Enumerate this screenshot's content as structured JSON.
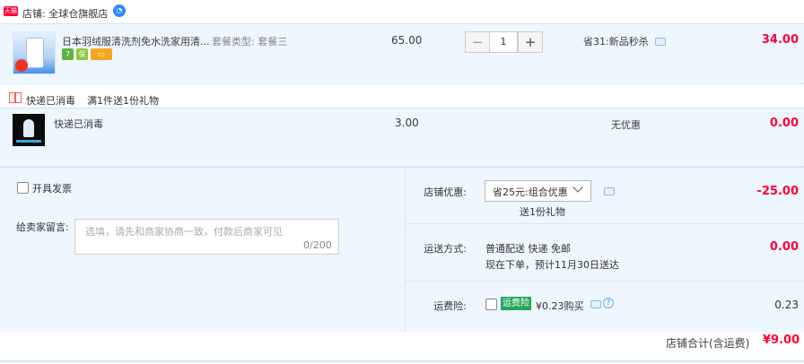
{
  "store": {
    "badge": "天猫",
    "name": "店铺: 全球仓旗舰店",
    "chat_icon": "wangwang-icon"
  },
  "items": [
    {
      "title": "日本羽绒服清洗剂免水洗家用清...",
      "sku": "套餐类型: 套餐三",
      "price": "65.00",
      "quantity": "1",
      "minus": "−",
      "plus": "+",
      "promo": "省31:新品秒杀",
      "subtotal": "34.00",
      "service_tags": [
        {
          "text": "7",
          "color": "#5ab33f"
        },
        {
          "text": "保",
          "color": "#8fc63d"
        },
        {
          "text": "▭",
          "color": "#f5a623"
        }
      ]
    },
    {
      "title": "快递已消毒",
      "price": "3.00",
      "promo": "无优惠",
      "subtotal": "0.00"
    }
  ],
  "gift": {
    "label": "快递已消毒",
    "desc": "满1件送1份礼物",
    "icon": "gift-icon"
  },
  "invoice": {
    "label": "开具发票",
    "checked": false
  },
  "message": {
    "label": "给卖家留言:",
    "placeholder": "选填，请先和商家协商一致，付款后商家可见",
    "count": "0/200"
  },
  "discount": {
    "label": "店铺优惠:",
    "selected": "省25元:组合优惠",
    "gift_note": "送1份礼物",
    "amount": "-25.00"
  },
  "shipping": {
    "label": "运送方式:",
    "line1": "普通配送 快递 免邮",
    "line2": "现在下单，预计11月30日送达",
    "amount": "0.00"
  },
  "insurance": {
    "label": "运费险:",
    "tag": "运费险",
    "text": "¥0.23购买",
    "amount": "0.23",
    "checked": false
  },
  "total": {
    "label": "店铺合计(含运费)",
    "amount": "¥9.00"
  },
  "colors": {
    "accent_red": "#ff0036",
    "row_bg": "#eef6ff",
    "border": "#cfe3f7",
    "insurance_green": "#23a85b"
  }
}
